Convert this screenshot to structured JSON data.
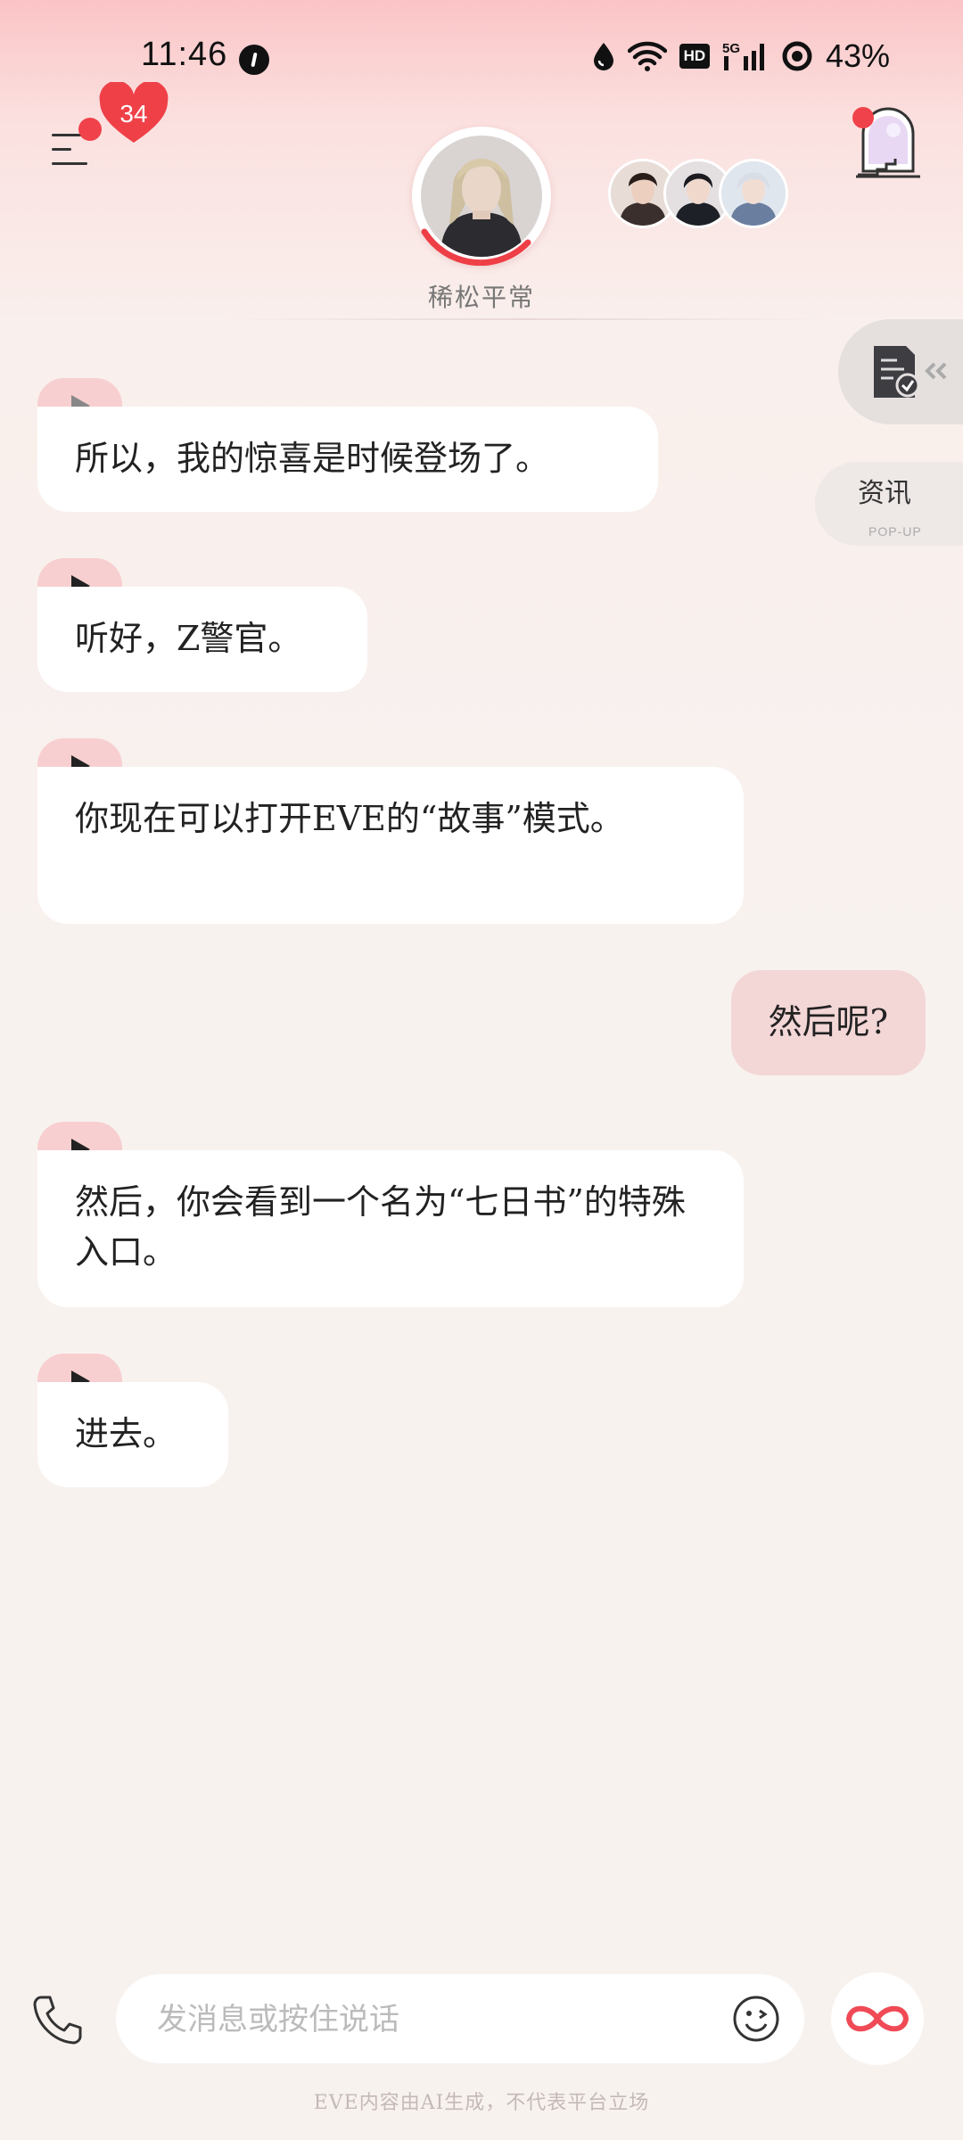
{
  "status_bar": {
    "time": "11:46",
    "network": "5G",
    "hd_label": "HD",
    "battery": "43%"
  },
  "header": {
    "character_name": "稀松平常",
    "affection_level": "34",
    "menu_icon": "menu-icon",
    "scene_icon": "scene-portal-icon"
  },
  "side_panel": {
    "tasks_icon": "task-checklist-icon",
    "news_title": "资讯",
    "news_subtitle": "POP-UP"
  },
  "messages": [
    {
      "sender": "character",
      "text": "所以，我的惊喜是时候登场了。"
    },
    {
      "sender": "character",
      "text": "听好，Z警官。"
    },
    {
      "sender": "character",
      "text": "你现在可以打开EVE的“故事”模式。"
    },
    {
      "sender": "user",
      "text": "然后呢?"
    },
    {
      "sender": "character",
      "text": "然后，你会看到一个名为“七日书”的特殊入口。"
    },
    {
      "sender": "character",
      "text": "进去。"
    }
  ],
  "input": {
    "placeholder": "发消息或按住说话",
    "value": ""
  },
  "footer": {
    "disclaimer": "EVE内容由AI生成，不代表平台立场"
  },
  "colors": {
    "accent": "#f0424b",
    "play_tab": "#f8cfd0",
    "user_bubble": "#f3d6d6"
  }
}
